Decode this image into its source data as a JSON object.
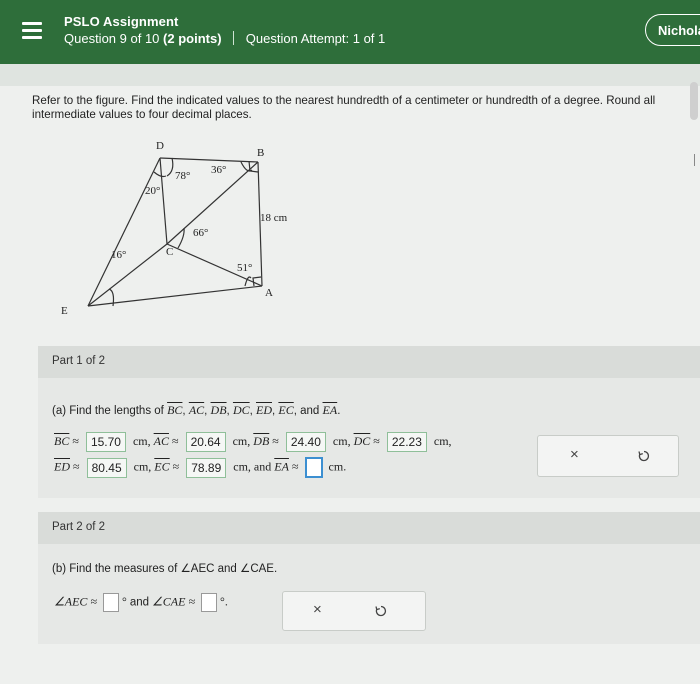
{
  "header": {
    "assignment_title": "PSLO Assignment",
    "question_progress": "Question 9 of 10",
    "points": "(2 points)",
    "attempt": "Question Attempt: 1 of 1",
    "user_name": "Nichola"
  },
  "instructions": "Refer to the figure. Find the indicated values to the nearest hundredth of a centimeter or hundredth of a degree. Round all intermediate values to four decimal places.",
  "figure": {
    "vertices": {
      "D": "D",
      "B": "B",
      "C": "C",
      "E": "E",
      "A": "A"
    },
    "angles": {
      "a78": "78°",
      "a36": "36°",
      "a20": "20°",
      "a66": "66°",
      "a16": "16°",
      "a51": "51°"
    },
    "side_label": "18 cm"
  },
  "part1": {
    "label": "Part 1 of 2",
    "prompt_prefix": "(a) Find the lengths of",
    "segments": [
      "BC",
      "AC",
      "DB",
      "DC",
      "ED",
      "EC"
    ],
    "and_word": "and",
    "last_segment": "EA",
    "period": ".",
    "answers": [
      {
        "label": "BC",
        "value": "15.70",
        "unit": "cm,"
      },
      {
        "label": "AC",
        "value": "20.64",
        "unit": "cm,"
      },
      {
        "label": "DB",
        "value": "24.40",
        "unit": "cm,"
      },
      {
        "label": "DC",
        "value": "22.23",
        "unit": "cm,"
      },
      {
        "label": "ED",
        "value": "80.45",
        "unit": "cm,"
      },
      {
        "label": "EC",
        "value": "78.89",
        "unit": "cm, and"
      },
      {
        "label": "EA",
        "value": "",
        "unit": "cm."
      }
    ],
    "approx": "≈"
  },
  "part2": {
    "label": "Part 2 of 2",
    "prompt": "(b) Find the measures of ∠AEC and ∠CAE.",
    "angle1_label": "∠AEC ≈",
    "and_word": "and",
    "angle2_label": "∠CAE ≈",
    "degree": "°",
    "period": "."
  },
  "buttons": {
    "clear": "×",
    "undo": "undo-icon"
  },
  "colors": {
    "header_bg": "#2e6e3a",
    "answer_border": "#8fbf99",
    "active_input": "#3c8fd1"
  }
}
